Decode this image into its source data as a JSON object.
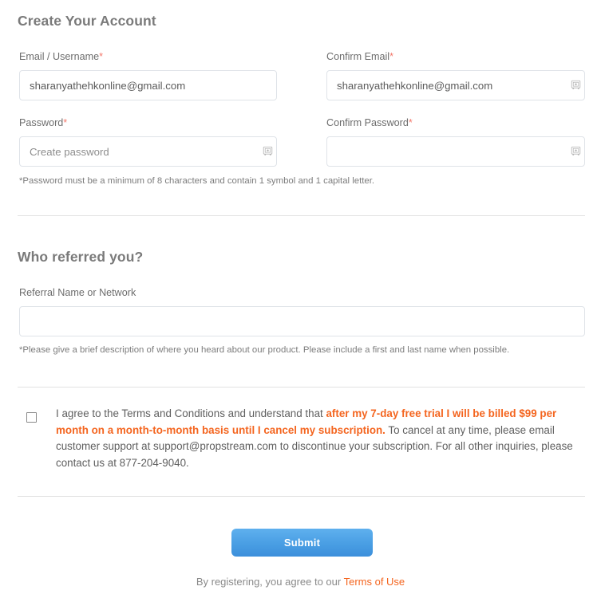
{
  "account_section": {
    "title": "Create Your Account",
    "fields": [
      {
        "label": "Email / Username",
        "required_mark": "*",
        "value": "sharanyathehkonline@gmail.com",
        "placeholder": ""
      },
      {
        "label": "Confirm Email",
        "required_mark": "*",
        "value": "sharanyathehkonline@gmail.com",
        "placeholder": ""
      },
      {
        "label": "Password",
        "required_mark": "*",
        "value": "",
        "placeholder": "Create password"
      },
      {
        "label": "Confirm Password",
        "required_mark": "*",
        "value": "",
        "placeholder": ""
      }
    ],
    "password_hint": "*Password must be a minimum of 8 characters and contain 1 symbol and 1 capital letter.",
    "vault_icon_name": "password-manager-vault-icon"
  },
  "referral_section": {
    "title": "Who referred you?",
    "label": "Referral Name or Network",
    "value": "",
    "placeholder": "",
    "hint": "*Please give a brief description of where you heard about our product. Please include a first and last name when possible."
  },
  "terms_section": {
    "checkbox_checked": false,
    "text_part_1": "I agree to the Terms and Conditions and understand that ",
    "text_emphasis": "after my 7-day free trial I will be billed $99 per month on a month-to-month basis until I cancel my subscription.",
    "text_part_2": " To cancel at any time, please email customer support at support@propstream.com to discontinue your subscription. For all other inquiries, please contact us at 877-204-9040."
  },
  "footer": {
    "submit_label": "Submit",
    "note_prefix": "By registering, you agree to our ",
    "link_label": "Terms of Use"
  },
  "colors": {
    "accent_orange": "#f4651f",
    "required_red": "#f4776a",
    "button_blue_top": "#5fb0ee",
    "button_blue_bottom": "#3c8fdb",
    "divider_gray": "#e2e2e2",
    "input_border": "#dfe3e8",
    "heading_gray": "#7a7a7a"
  }
}
